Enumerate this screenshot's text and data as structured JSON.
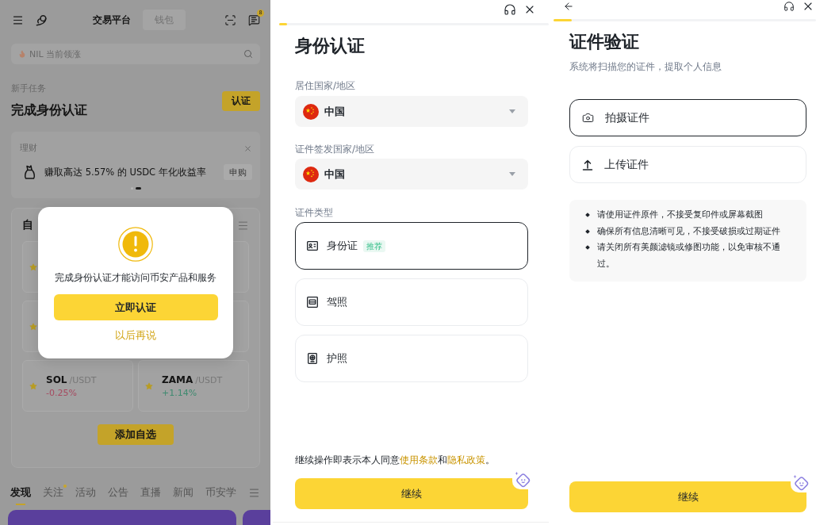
{
  "home": {
    "top_bar": {
      "tabs": [
        {
          "label": "交易平台",
          "selected": true
        },
        {
          "label": "钱包",
          "selected": false
        }
      ],
      "notification_count": "8"
    },
    "search": {
      "placeholder": "NIL 当前领涨"
    },
    "task": {
      "caption": "新手任务",
      "title": "完成身份认证",
      "button": "认证"
    },
    "earn_card": {
      "label": "理财",
      "text": "赚取高达 5.57% 的 USDC 年化收益率",
      "button": "申购",
      "pages": [
        {
          "selected": false
        },
        {
          "selected": true
        }
      ]
    },
    "watchlist": {
      "title": "自",
      "pairs": [
        {
          "kind": "star"
        },
        {
          "kind": "blank"
        },
        {
          "kind": "star"
        },
        {
          "kind": "blank"
        },
        {
          "kind": "pair",
          "base": "SOL",
          "quote": "/USDT",
          "change": "-0.25%",
          "color": "#a64a60"
        },
        {
          "kind": "pair",
          "base": "ZAMA",
          "quote": "/USDT",
          "change": "+1.14%",
          "color": "#3f8a70"
        }
      ],
      "add_button": "添加自选"
    },
    "bottom_tabs": [
      {
        "label": "发现",
        "selected": true,
        "dot": false
      },
      {
        "label": "关注",
        "selected": false,
        "dot": true
      },
      {
        "label": "活动",
        "selected": false,
        "dot": false
      },
      {
        "label": "公告",
        "selected": false,
        "dot": false
      },
      {
        "label": "直播",
        "selected": false,
        "dot": false
      },
      {
        "label": "新闻",
        "selected": false,
        "dot": false
      },
      {
        "label": "币安学",
        "selected": false,
        "dot": false
      }
    ]
  },
  "verify_dialog": {
    "message": "完成身份认证才能访问币安产品和服务",
    "confirm_button": "立即认证",
    "later_link": "以后再说"
  },
  "identity_screen": {
    "progress": {
      "level": 0.03
    },
    "title": "身份认证",
    "fields": [
      {
        "label": "居住国家/地区",
        "value": "中国"
      },
      {
        "label": "证件签发国家/地区",
        "value": "中国"
      }
    ],
    "document_type": {
      "label": "证件类型",
      "options": [
        {
          "kind": "id_card",
          "label": "身份证",
          "tag": "推荐",
          "selected": true
        },
        {
          "kind": "license",
          "label": "驾照",
          "selected": false
        },
        {
          "kind": "passport",
          "label": "护照",
          "selected": false
        }
      ]
    },
    "consent": [
      {
        "kind": "text",
        "text": "继续操作即表示本人同意"
      },
      {
        "kind": "link",
        "text": "使用条款"
      },
      {
        "kind": "text",
        "text": "和"
      },
      {
        "kind": "link",
        "text": "隐私政策"
      },
      {
        "kind": "text",
        "text": "。"
      }
    ],
    "continue_button": "继续"
  },
  "document_screen": {
    "progress": {
      "level": 0.07
    },
    "title": "证件验证",
    "subtitle": "系统将扫描您的证件，提取个人信息",
    "methods": [
      {
        "kind": "camera",
        "label": "拍摄证件",
        "selected": true
      },
      {
        "kind": "upload",
        "label": "上传证件",
        "selected": false
      }
    ],
    "tips": [
      "请使用证件原件，不接受复印件或屏幕截图",
      "确保所有信息清晰可见，不接受破损或过期证件",
      "请关闭所有美颜滤镜或修图功能，以免审核不通过。"
    ],
    "continue_button": "继续"
  }
}
